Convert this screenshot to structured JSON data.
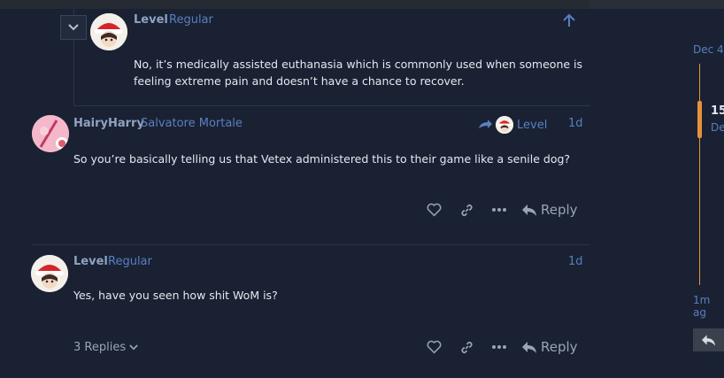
{
  "embedded_post": {
    "username": "Level",
    "user_title": "Regular",
    "text_line1": "No, it’s medically assisted euthanasia which is commonly used when someone is",
    "text_line2": "feeling extreme pain and doesn’t have a chance to recover."
  },
  "post1": {
    "username": "HairyHarry",
    "user_title": "Salvatore Mortale",
    "reply_to_user": "Level",
    "date": "1d",
    "text": "So you’re basically telling us that Vetex administered this to their game like a senile dog?",
    "reply_label": "Reply"
  },
  "post2": {
    "username": "Level",
    "user_title": "Regular",
    "date": "1d",
    "text": "Yes, have you seen how shit WoM is?",
    "replies_label": "3 Replies",
    "reply_label": "Reply"
  },
  "timeline": {
    "start_label": "Dec 4",
    "current_num": "15",
    "current_sub": "De",
    "end_label": "1m ag"
  },
  "icons": {
    "collapse": "chevron-down-icon",
    "jump_up": "arrow-up-icon",
    "like": "heart-icon",
    "link": "link-icon",
    "more": "ellipsis-icon",
    "reply": "reply-icon",
    "back": "back-arrow-icon"
  },
  "colors": {
    "background": "#192133",
    "accent_blue": "#5a7fc0",
    "timeline_orange": "#e8903b"
  }
}
